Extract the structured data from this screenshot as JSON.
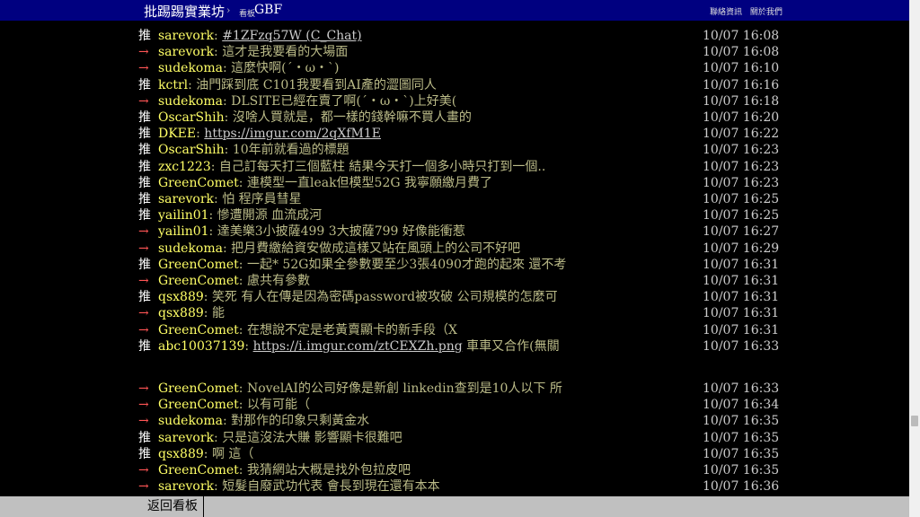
{
  "header": {
    "board_name": "批踢踢實業坊",
    "separator": "›",
    "board_tag": "看板",
    "board_id": "GBF",
    "links": [
      "聯絡資訊",
      "關於我們"
    ]
  },
  "pushes": [
    {
      "tag": "推",
      "user": "sarevork",
      "content": "#1ZFzq57W (C_Chat)",
      "link": true,
      "time": "10/07 16:08"
    },
    {
      "tag": "→",
      "user": "sarevork",
      "content": "這才是我要看的大場面",
      "time": "10/07 16:08"
    },
    {
      "tag": "→",
      "user": "sudekoma",
      "content": "這麼快啊(´・ω・`)",
      "time": "10/07 16:10"
    },
    {
      "tag": "推",
      "user": "kctrl",
      "content": "油門踩到底 C101我要看到AI產的澀圖同人",
      "time": "10/07 16:16"
    },
    {
      "tag": "→",
      "user": "sudekoma",
      "content": "DLSITE已經在賣了啊(´・ω・`)上好美(",
      "time": "10/07 16:18"
    },
    {
      "tag": "推",
      "user": "OscarShih",
      "content": "沒啥人買就是，都一樣的錢幹嘛不買人畫的",
      "time": "10/07 16:20"
    },
    {
      "tag": "推",
      "user": "DKEE",
      "content": "https://imgur.com/2qXfM1E",
      "link": true,
      "time": "10/07 16:22"
    },
    {
      "tag": "推",
      "user": "OscarShih",
      "content": "10年前就看過的標題",
      "time": "10/07 16:23"
    },
    {
      "tag": "推",
      "user": "zxc1223",
      "content": "自己訂每天打三個藍柱 結果今天打一個多小時只打到一個..",
      "time": "10/07 16:23"
    },
    {
      "tag": "推",
      "user": "GreenComet",
      "content": "連模型一直leak但模型52G 我寧願繳月費了",
      "time": "10/07 16:23"
    },
    {
      "tag": "推",
      "user": "sarevork",
      "content": "怕 程序員彗星",
      "time": "10/07 16:25"
    },
    {
      "tag": "推",
      "user": "yailin01",
      "content": "慘遭開源 血流成河",
      "time": "10/07 16:25"
    },
    {
      "tag": "→",
      "user": "yailin01",
      "content": "達美樂3小披薩499 3大披薩799 好像能衝惹",
      "time": "10/07 16:27"
    },
    {
      "tag": "→",
      "user": "sudekoma",
      "content": "把月費繳給資安做成這樣又站在風頭上的公司不好吧",
      "time": "10/07 16:29"
    },
    {
      "tag": "推",
      "user": "GreenComet",
      "content": "一起* 52G如果全參數要至少3張4090才跑的起來 還不考",
      "time": "10/07 16:31"
    },
    {
      "tag": "→",
      "user": "GreenComet",
      "content": "慮共有參數",
      "time": "10/07 16:31"
    },
    {
      "tag": "推",
      "user": "qsx889",
      "content": "笑死 有人在傳是因為密碼password被攻破 公司規模的怎麼可",
      "time": "10/07 16:31"
    },
    {
      "tag": "→",
      "user": "qsx889",
      "content": "能",
      "time": "10/07 16:31"
    },
    {
      "tag": "→",
      "user": "GreenComet",
      "content": "在想說不定是老黃賣顯卡的新手段（X",
      "time": "10/07 16:31"
    },
    {
      "tag": "推",
      "user": "abc10037139",
      "content": "https://i.imgur.com/ztCEXZh.png",
      "link": true,
      "extra": " 車車又合作(無關",
      "time": "10/07 16:33"
    },
    {
      "tag": "→",
      "user": "GreenComet",
      "content": "NovelAI的公司好像是新創 linkedin查到是10人以下 所",
      "time": "10/07 16:33"
    },
    {
      "tag": "→",
      "user": "GreenComet",
      "content": "以有可能（",
      "time": "10/07 16:34"
    },
    {
      "tag": "→",
      "user": "sudekoma",
      "content": "對那作的印象只剩黃金水",
      "time": "10/07 16:35"
    },
    {
      "tag": "推",
      "user": "sarevork",
      "content": "只是這沒法大賺 影響顯卡很難吧",
      "time": "10/07 16:35"
    },
    {
      "tag": "推",
      "user": "qsx889",
      "content": "啊 這（",
      "time": "10/07 16:35"
    },
    {
      "tag": "→",
      "user": "GreenComet",
      "content": "我猜網站大概是找外包拉皮吧",
      "time": "10/07 16:35"
    },
    {
      "tag": "→",
      "user": "sarevork",
      "content": "短髮自廢武功代表 會長到現在還有本本",
      "time": "10/07 16:36"
    }
  ],
  "footer": {
    "back_label": "返回看板"
  }
}
